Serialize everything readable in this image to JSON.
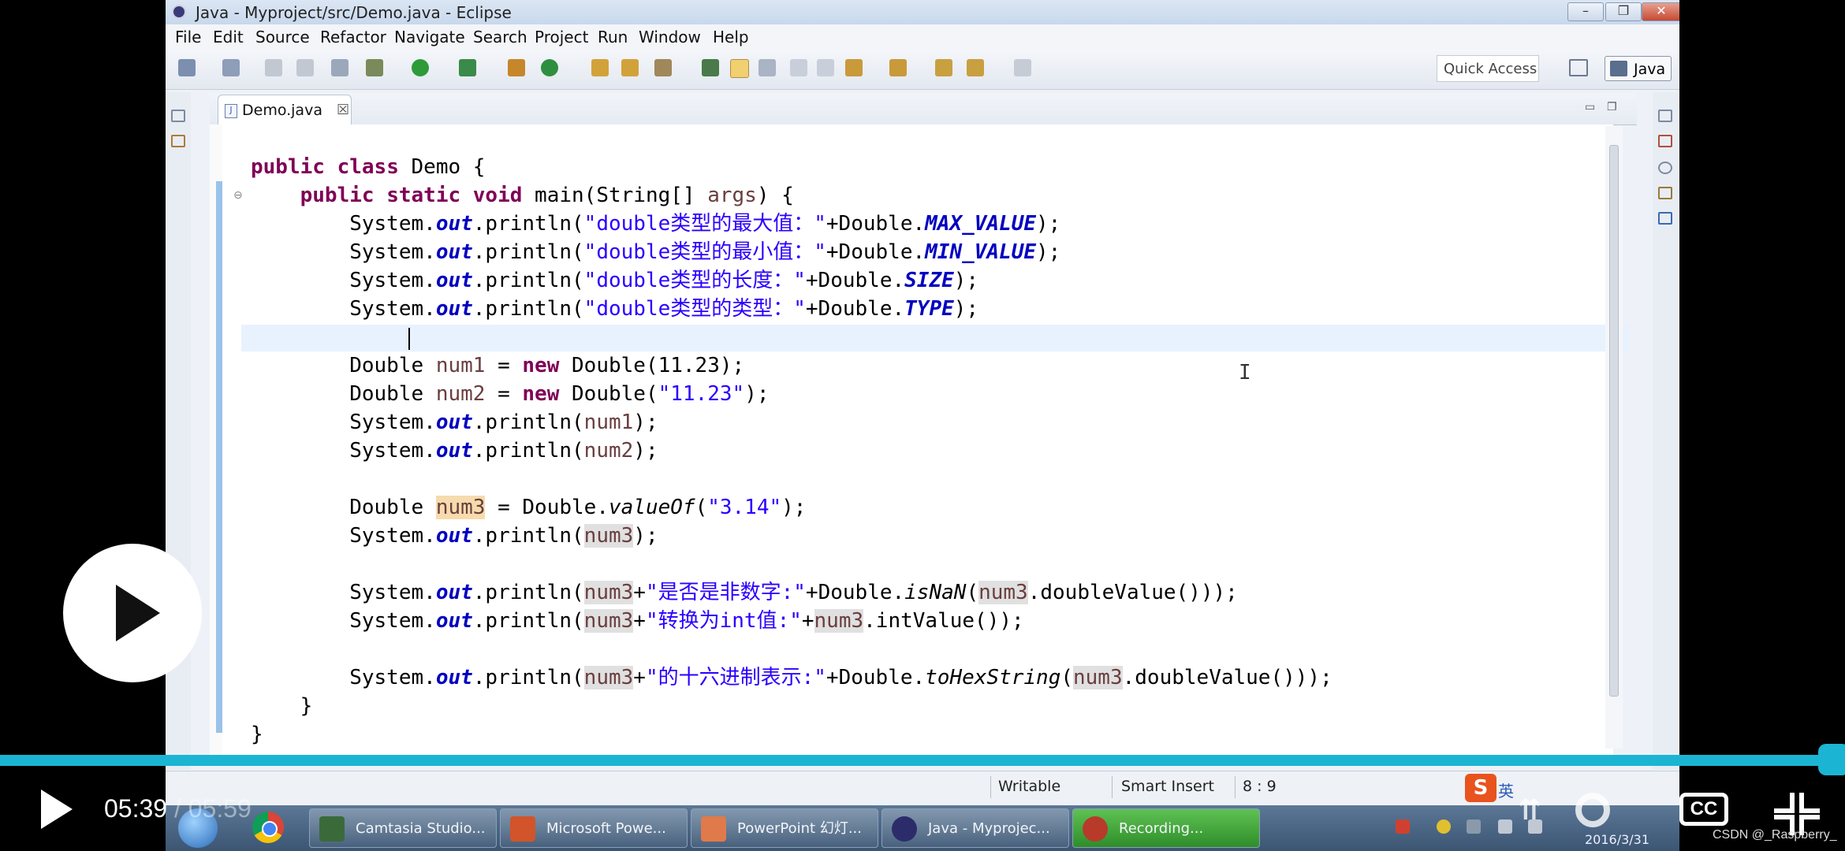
{
  "window": {
    "title": "Java - Myproject/src/Demo.java - Eclipse",
    "min_glyph": "–",
    "max_glyph": "❐",
    "close_glyph": "✕"
  },
  "menu": [
    "File",
    "Edit",
    "Source",
    "Refactor",
    "Navigate",
    "Search",
    "Project",
    "Run",
    "Window",
    "Help"
  ],
  "toolbar": {
    "quick_access": "Quick Access",
    "perspective": "Java"
  },
  "editor": {
    "tab_label": "Demo.java",
    "tab_close": "☒",
    "file_icon": "J",
    "code_lines": [
      "public class Demo {",
      "    public static void main(String[] args) {",
      "        System.out.println(\"double类型的最大值：\"+Double.MAX_VALUE);",
      "        System.out.println(\"double类型的最小值：\"+Double.MIN_VALUE);",
      "        System.out.println(\"double类型的长度：\"+Double.SIZE);",
      "        System.out.println(\"double类型的类型：\"+Double.TYPE);",
      "",
      "        Double num1 = new Double(11.23);",
      "        Double num2 = new Double(\"11.23\");",
      "        System.out.println(num1);",
      "        System.out.println(num2);",
      "",
      "        Double num3 = Double.valueOf(\"3.14\");",
      "        System.out.println(num3);",
      "",
      "        System.out.println(num3+\"是否是非数字:\"+Double.isNaN(num3.doubleValue()));",
      "        System.out.println(num3+\"转换为int值:\"+num3.intValue());",
      "",
      "        System.out.println(num3+\"的十六进制表示:\"+Double.toHexString(num3.doubleValue()));",
      "    }",
      "}"
    ],
    "cursor_text": "I"
  },
  "statusbar": {
    "writable": "Writable",
    "insert_mode": "Smart Insert",
    "position": "8 : 9"
  },
  "taskbar": {
    "items": [
      {
        "label": "Camtasia Studio..."
      },
      {
        "label": "Microsoft Powe..."
      },
      {
        "label": "PowerPoint 幻灯..."
      },
      {
        "label": "Java - Myprojec..."
      },
      {
        "label": "Recording..."
      }
    ],
    "ime_logo": "S",
    "ime_lang": "英",
    "clock_date": "2016/3/31"
  },
  "player": {
    "current_time": "05:39",
    "duration": "/ 05:59",
    "progress_fraction": 0.987,
    "cc_label": "CC",
    "watermark": "CSDN @_Raspberry_"
  },
  "colors": {
    "accent_progress": "#1bb5d3",
    "keyword": "#7f0055",
    "string": "#2a00ff",
    "field": "#0000c0"
  }
}
